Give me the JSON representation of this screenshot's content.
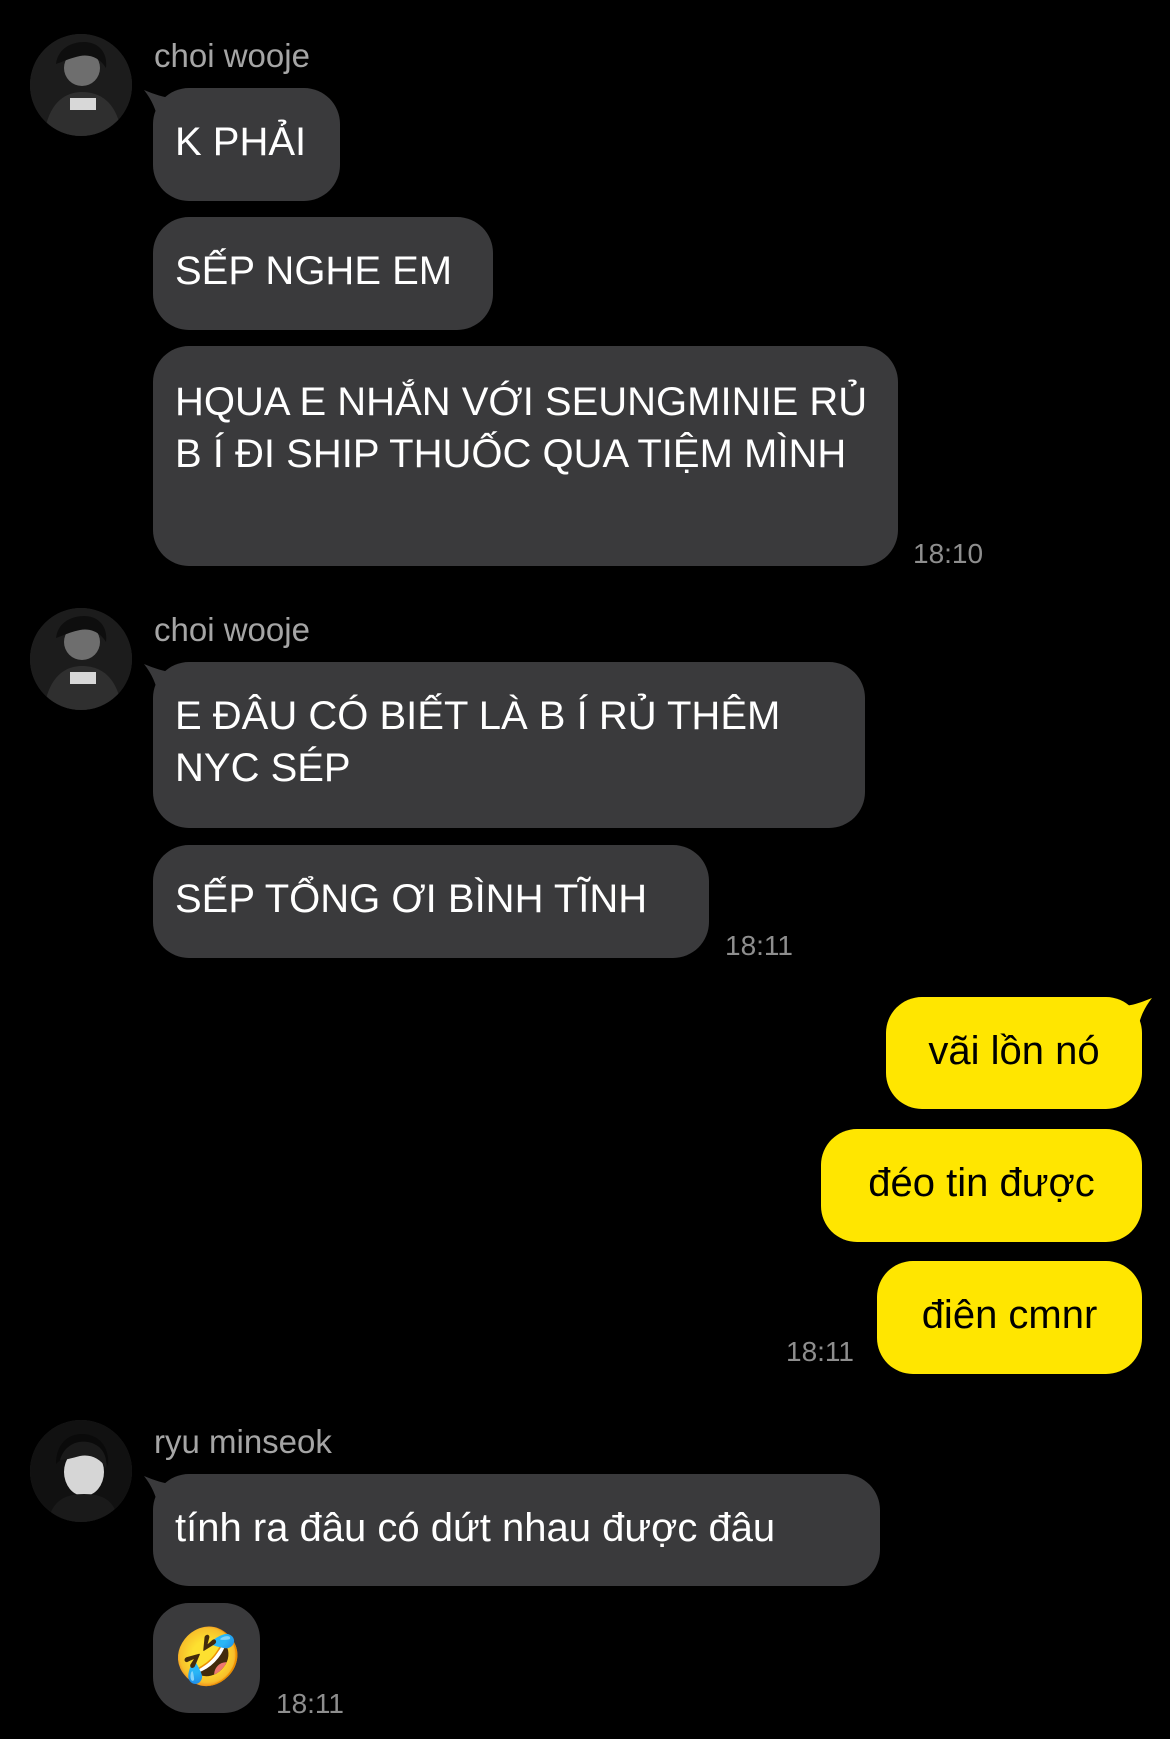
{
  "colors": {
    "background": "#000000",
    "incoming_bubble": "#3a3a3c",
    "outgoing_bubble": "#ffe600",
    "sender_name": "#a5a5a5",
    "timestamp": "#8e8e8e"
  },
  "groups": [
    {
      "sender": "choi wooje",
      "avatar_icon": "user-avatar-icon",
      "messages": [
        "K PHẢI",
        "SẾP NGHE EM",
        "HQUA E NHẮN VỚI SEUNGMINIE RỦ B Í ĐI SHIP THUỐC QUA TIỆM MÌNH"
      ],
      "time": "18:10"
    },
    {
      "sender": "choi wooje",
      "avatar_icon": "user-avatar-icon",
      "messages": [
        "E ĐÂU CÓ BIẾT LÀ B Í RỦ THÊM NYC SÉP",
        "SẾP TỔNG ƠI BÌNH TĨNH"
      ],
      "time": "18:11"
    },
    {
      "sender": "me",
      "messages": [
        "vãi lồn nó",
        "đéo tin được",
        "điên cmnr"
      ],
      "time": "18:11"
    },
    {
      "sender": "ryu minseok",
      "avatar_icon": "user-avatar-icon",
      "messages": [
        "tính ra đâu có dứt nhau được đâu",
        "🤣"
      ],
      "time": "18:11"
    }
  ]
}
